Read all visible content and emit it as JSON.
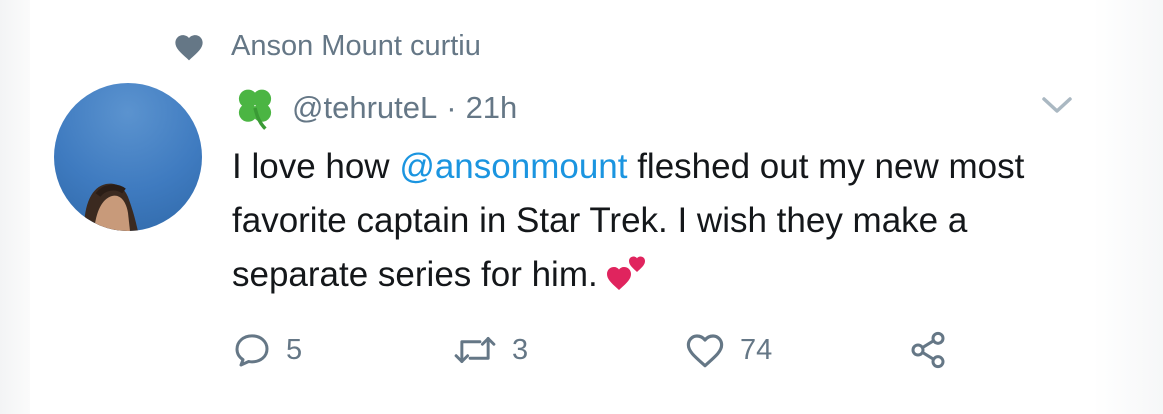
{
  "social_context": {
    "icon": "heart-icon",
    "text": "Anson Mount curtiu"
  },
  "tweet": {
    "handle": "@tehruteL",
    "separator": "·",
    "time": "21h",
    "text_before": "I love how ",
    "mention": "@ansonmount",
    "text_after": " fleshed out my new most favorite captain in Star Trek. I wish they make a separate series for him.",
    "emoji": "two-hearts-emoji"
  },
  "actions": {
    "reply_count": "5",
    "retweet_count": "3",
    "like_count": "74"
  },
  "colors": {
    "secondary_text": "#657786",
    "mention": "#1b95e0",
    "primary_text": "#14171a",
    "clover": "#4bb543",
    "heart_emoji": "#e0245e"
  }
}
